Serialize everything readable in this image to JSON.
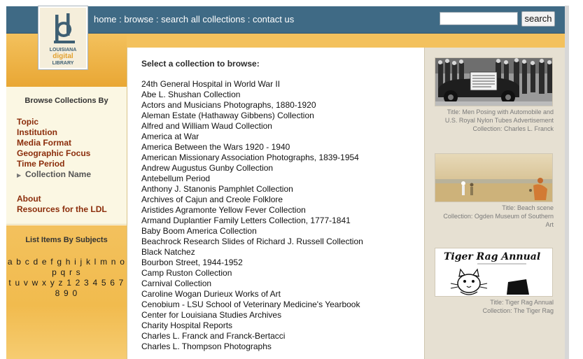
{
  "header": {
    "nav": [
      {
        "label": "home"
      },
      {
        "label": "browse"
      },
      {
        "label": "search all collections"
      },
      {
        "label": "contact us"
      }
    ],
    "nav_separator": " : ",
    "search": {
      "value": "",
      "button_label": "search"
    }
  },
  "logo": {
    "line1": "LOUISIANA",
    "line2": "digital",
    "line3": "LIBRARY"
  },
  "sidebar": {
    "browse_title": "Browse Collections By",
    "browse_items": [
      "Topic",
      "Institution",
      "Media Format",
      "Geographic Focus",
      "Time Period"
    ],
    "current_item": "Collection Name",
    "extra_links": [
      "About",
      "Resources for the LDL"
    ],
    "subjects_title": "List Items By Subjects",
    "alphabet_line1": "a b c d e f g h i j k l m n o p q r s",
    "alphabet_line2": "t u v w x y z 1 2 3 4 5 6 7 8 9 0"
  },
  "main": {
    "title": "Select a collection to browse:",
    "collections": [
      "24th General Hospital in World War II",
      "Abe L. Shushan Collection",
      "Actors and Musicians Photographs, 1880-1920",
      "Aleman Estate (Hathaway Gibbens) Collection",
      "Alfred and William Waud Collection",
      "America at War",
      "America Between the Wars 1920 - 1940",
      "American Missionary Association Photographs, 1839-1954",
      "Andrew Augustus Gunby Collection",
      "Antebellum Period",
      "Anthony J. Stanonis Pamphlet Collection",
      "Archives of Cajun and Creole Folklore",
      "Aristides Agramonte Yellow Fever Collection",
      "Armand Duplantier Family Letters Collection, 1777-1841",
      "Baby Boom America Collection",
      "Beachrock Research Slides of Richard J. Russell Collection",
      "Black Natchez",
      "Bourbon Street, 1944-1952",
      "Camp Ruston Collection",
      "Carnival Collection",
      "Caroline Wogan Durieux Works of Art",
      "Cenobium - LSU School of Veterinary Medicine's Yearbook",
      "Center for Louisiana Studies Archives",
      "Charity Hospital Reports",
      "Charles L. Franck and Franck-Bertacci",
      "Charles L. Thompson Photographs"
    ]
  },
  "featured": [
    {
      "line1": "Title: Men Posing with Automobile and",
      "line2": "U.S. Royal Nylon Tubes Advertisement",
      "line3": "Collection: Charles L. Franck"
    },
    {
      "line1": "Title: Beach scene",
      "line2": "Collection: Ogden Museum of Southern",
      "line3": "Art"
    },
    {
      "line1": "Title: Tiger Rag Annual",
      "line2": "Collection: The Tiger Rag",
      "image_text": "Tiger Rag Annual"
    }
  ],
  "colors": {
    "header_blue": "#3f6a85",
    "accent_orange": "#f3c15d",
    "link_brown": "#8b2d0b",
    "panel_cream": "#fbf7e3",
    "right_bg": "#e6e0d2"
  }
}
